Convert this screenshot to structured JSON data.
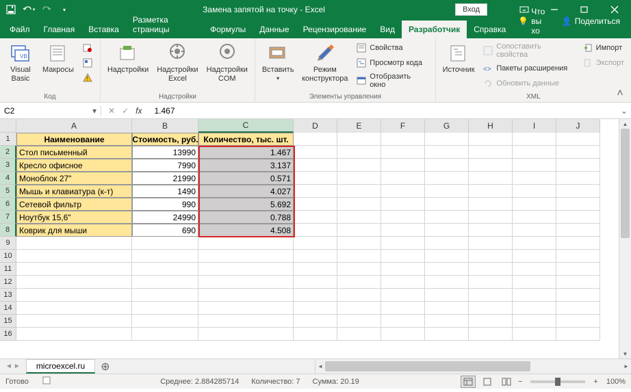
{
  "title": "Замена запятой на точку  -  Excel",
  "login": "Вход",
  "qat": {
    "save": "💾",
    "undo": "↶",
    "redo": "↷"
  },
  "tabs": {
    "file": "Файл",
    "home": "Главная",
    "insert": "Вставка",
    "layout": "Разметка страницы",
    "formulas": "Формулы",
    "data": "Данные",
    "review": "Рецензирование",
    "view": "Вид",
    "developer": "Разработчик",
    "help": "Справка",
    "tell_me": "Что вы хо",
    "share": "Поделиться"
  },
  "ribbon": {
    "code": {
      "visual_basic": "Visual\nBasic",
      "macros": "Макросы",
      "record": "Запись макроса",
      "relative": "Относительные ссылки",
      "security": "Безопасность макросов",
      "label": "Код"
    },
    "addins": {
      "addins": "Надстройки",
      "excel_addins": "Надстройки\nExcel",
      "com_addins": "Надстройки\nCOM",
      "label": "Надстройки"
    },
    "controls": {
      "insert": "Вставить",
      "design": "Режим\nконструктора",
      "properties": "Свойства",
      "view_code": "Просмотр кода",
      "dialog": "Отобразить окно",
      "label": "Элементы управления"
    },
    "xml": {
      "source": "Источник",
      "map_props": "Сопоставить свойства",
      "expansion": "Пакеты расширения",
      "refresh": "Обновить данные",
      "import": "Импорт",
      "export": "Экспорт",
      "label": "XML"
    }
  },
  "namebox": "C2",
  "formula": "1.467",
  "columns": [
    "A",
    "B",
    "C",
    "D",
    "E",
    "F",
    "G",
    "H",
    "I",
    "J"
  ],
  "headers": {
    "A": "Наименование",
    "B": "Стоимость, руб.",
    "C": "Количество, тыс. шт."
  },
  "rows": [
    {
      "n": 1,
      "A": "Наименование",
      "B": "Стоимость, руб.",
      "C": "Количество, тыс. шт."
    },
    {
      "n": 2,
      "A": "Стол письменный",
      "B": "13990",
      "C": "1.467"
    },
    {
      "n": 3,
      "A": "Кресло офисное",
      "B": "7990",
      "C": "3.137"
    },
    {
      "n": 4,
      "A": "Моноблок 27\"",
      "B": "21990",
      "C": "0.571"
    },
    {
      "n": 5,
      "A": "Мышь и клавиатура (к-т)",
      "B": "1490",
      "C": "4.027"
    },
    {
      "n": 6,
      "A": "Сетевой фильтр",
      "B": "990",
      "C": "5.692"
    },
    {
      "n": 7,
      "A": "Ноутбук 15,6\"",
      "B": "24990",
      "C": "0.788"
    },
    {
      "n": 8,
      "A": "Коврик для мыши",
      "B": "690",
      "C": "4.508"
    }
  ],
  "sheet_tab": "microexcel.ru",
  "status": {
    "ready": "Готово",
    "avg_label": "Среднее:",
    "avg": "2.884285714",
    "count_label": "Количество:",
    "count": "7",
    "sum_label": "Сумма:",
    "sum": "20.19",
    "zoom": "100%"
  }
}
